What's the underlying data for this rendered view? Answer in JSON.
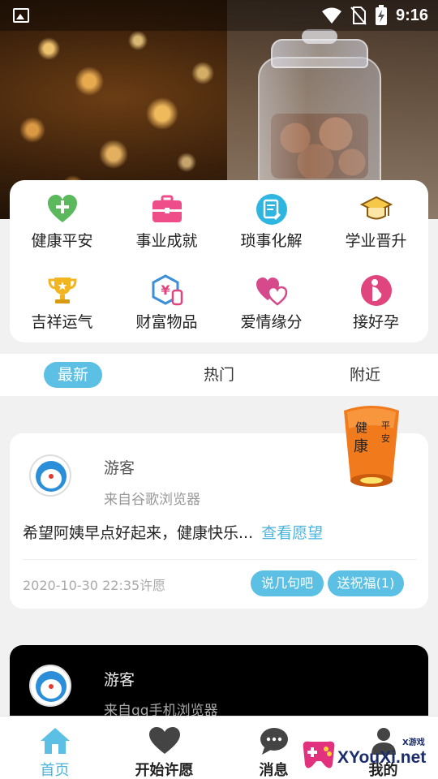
{
  "status_bar": {
    "time": "9:16",
    "icons": [
      "image-icon",
      "wifi-icon",
      "no-sim-icon",
      "battery-charging-icon"
    ]
  },
  "categories": [
    {
      "label": "健康平安",
      "icon": "health-heart-icon",
      "color": "#5cb85c"
    },
    {
      "label": "事业成就",
      "icon": "briefcase-icon",
      "color": "#ee4d8a"
    },
    {
      "label": "琐事化解",
      "icon": "document-edit-icon",
      "color": "#2fb6e0"
    },
    {
      "label": "学业晋升",
      "icon": "graduation-cap-icon",
      "color": "#d49a2a"
    },
    {
      "label": "吉祥运气",
      "icon": "trophy-icon",
      "color": "#f2b51f"
    },
    {
      "label": "财富物品",
      "icon": "money-hexagon-icon",
      "color": "#3a8fd8"
    },
    {
      "label": "爱情缘分",
      "icon": "hearts-icon",
      "color": "#d6498a"
    },
    {
      "label": "接好孕",
      "icon": "pregnant-icon",
      "color": "#e0457e"
    }
  ],
  "tabs": [
    {
      "label": "最新",
      "active": true
    },
    {
      "label": "热门",
      "active": false
    },
    {
      "label": "附近",
      "active": false
    }
  ],
  "wishes": [
    {
      "user": "游客",
      "source": "来自谷歌浏览器",
      "text": "希望阿姨早点好起来，健康快乐...",
      "link": "查看愿望",
      "time": "2020-10-30 22:35许愿",
      "actions": [
        "说几句吧",
        "送祝福(1)"
      ],
      "lantern_text": [
        "健",
        "康",
        "平",
        "安"
      ]
    },
    {
      "user": "游客",
      "source": "来自qq手机浏览器"
    }
  ],
  "bottom_nav": [
    {
      "label": "首页",
      "icon": "home-icon",
      "active": true
    },
    {
      "label": "开始许愿",
      "icon": "heart-icon",
      "active": false
    },
    {
      "label": "消息",
      "icon": "chat-bubble-icon",
      "active": false
    },
    {
      "label": "我的",
      "icon": "person-icon",
      "active": false
    }
  ],
  "watermark": {
    "text": "XYouXi.net",
    "small": "X游戏"
  },
  "colors": {
    "accent": "#5bc0e3",
    "link": "#4ab3de"
  }
}
